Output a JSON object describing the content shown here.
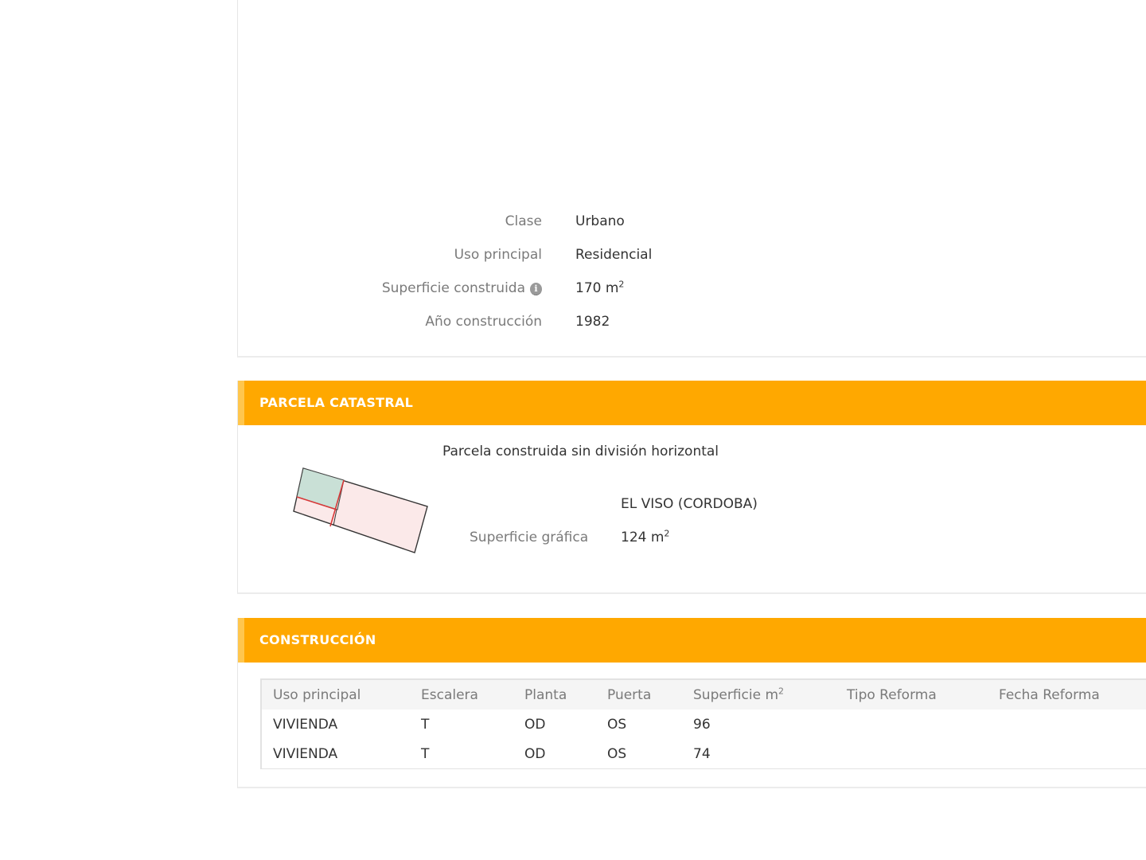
{
  "inmueble": {
    "rows": [
      {
        "label": "Clase",
        "value": "Urbano"
      },
      {
        "label": "Uso principal",
        "value": "Residencial"
      },
      {
        "label": "Superficie construida",
        "value": "170 m",
        "sup": "2",
        "icon": "info-icon"
      },
      {
        "label": "Año construcción",
        "value": "1982"
      }
    ]
  },
  "parcela": {
    "title": "PARCELA CATASTRAL",
    "description": "Parcela construida sin división horizontal",
    "municipio": "EL VISO (CORDOBA)",
    "superficie_label": "Superficie gráfica",
    "superficie_value": "124 m",
    "superficie_sup": "2"
  },
  "construccion": {
    "title": "CONSTRUCCIÓN",
    "headers": [
      "Uso principal",
      "Escalera",
      "Planta",
      "Puerta",
      "Superficie m",
      "Tipo Reforma",
      "Fecha Reforma"
    ],
    "superficie_header_sup": "2",
    "rows": [
      [
        "VIVIENDA",
        "T",
        "OD",
        "OS",
        "96",
        "",
        ""
      ],
      [
        "VIVIENDA",
        "T",
        "OD",
        "OS",
        "74",
        "",
        ""
      ]
    ]
  },
  "colors": {
    "header_orange": "#ffa800",
    "label_gray": "#7a7a7a",
    "parcel_green": "#c9e0d6",
    "parcel_pink": "#fbe9e9",
    "parcel_red": "#d83a3a"
  }
}
